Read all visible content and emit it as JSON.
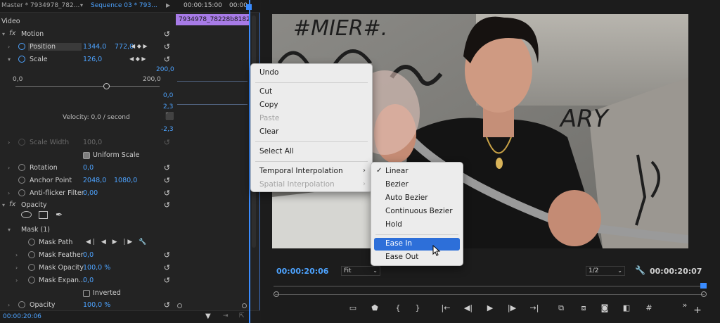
{
  "tabs": {
    "master": "Master * 7934978_782...",
    "sequence": "Sequence 03 * 793...",
    "tc_start": "00:00:15:00",
    "tc_end": "00:00"
  },
  "clip_name": "7934978_78228b8182",
  "section_label": "Video",
  "motion": {
    "label": "Motion",
    "position": {
      "label": "Position",
      "x": "1344,0",
      "y": "772,0"
    },
    "scale": {
      "label": "Scale",
      "value": "126,0"
    },
    "slider": {
      "min": "0,0",
      "max": "200,0",
      "max_right": "200,0",
      "value_fraction": 0.63
    },
    "graph": {
      "top": "0,0",
      "mid": "2,3",
      "bottom": "-2,3"
    },
    "velocity": "Velocity: 0,0 / second",
    "scale_width": {
      "label": "Scale Width",
      "value": "100,0"
    },
    "uniform_scale": "Uniform Scale",
    "rotation": {
      "label": "Rotation",
      "value": "0,0"
    },
    "anchor": {
      "label": "Anchor Point",
      "x": "2048,0",
      "y": "1080,0"
    },
    "anti_flicker": {
      "label": "Anti-flicker Filter",
      "value": "0,00"
    }
  },
  "opacity": {
    "label": "Opacity",
    "mask_label": "Mask (1)",
    "mask_path": "Mask Path",
    "mask_feather": {
      "label": "Mask Feather",
      "value": "0,0"
    },
    "mask_opacity": {
      "label": "Mask Opacity",
      "value": "100,0 %"
    },
    "mask_expansion": {
      "label": "Mask Expan...",
      "value": "0,0"
    },
    "inverted": "Inverted",
    "opacity_row": {
      "label": "Opacity",
      "value": "100,0 %"
    }
  },
  "bottom_tc": "00:00:20:06",
  "monitor": {
    "tc_current": "00:00:20:06",
    "fit": "Fit",
    "resolution": "1/2",
    "tc_duration": "00:00:20:07"
  },
  "context_menu": {
    "items": [
      "Undo",
      "Cut",
      "Copy",
      "Paste",
      "Clear",
      "Select All",
      "Temporal Interpolation",
      "Spatial Interpolation"
    ]
  },
  "submenu": {
    "items": [
      "Linear",
      "Bezier",
      "Auto Bezier",
      "Continuous Bezier",
      "Hold",
      "Ease In",
      "Ease Out"
    ],
    "checked": "Linear",
    "highlighted": "Ease In"
  },
  "colors": {
    "accent": "#4da3ff",
    "clip": "#a77be7",
    "highlight": "#2d6fd9",
    "playhead": "#3a8cff"
  },
  "graffiti": {
    "top": "#MIER#.",
    "right": "ARY"
  }
}
